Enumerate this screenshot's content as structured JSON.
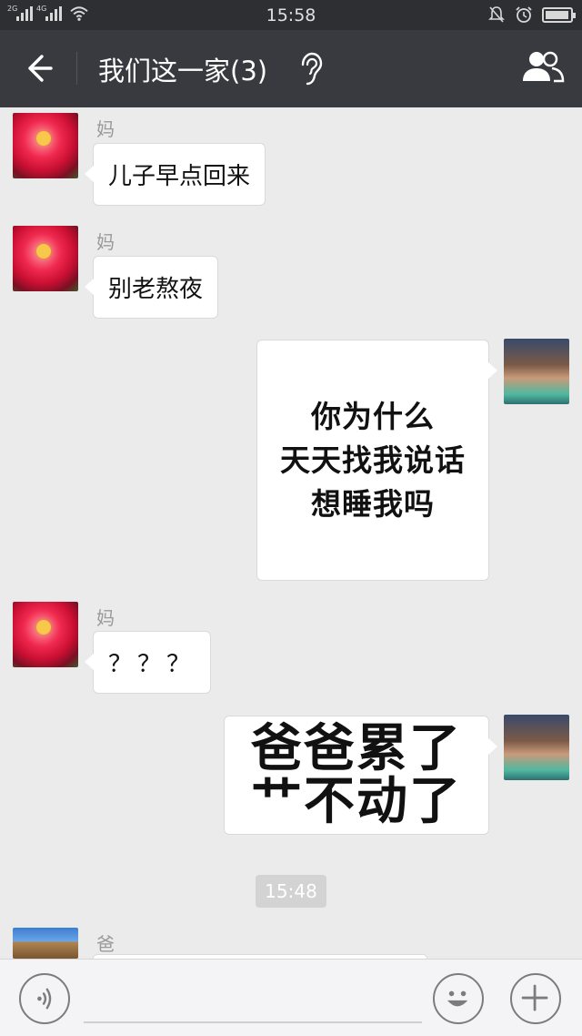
{
  "status_bar": {
    "network_1": "2G",
    "network_2": "4G",
    "time": "15:58",
    "battery_level": 0.95,
    "icons": [
      "signal-icon",
      "wifi-icon",
      "mute-bell-icon",
      "alarm-icon",
      "battery-icon"
    ]
  },
  "header": {
    "title": "我们这一家(3)",
    "back_icon": "arrow-left-icon",
    "earpiece_icon": "ear-icon",
    "group_icon": "group-people-icon"
  },
  "messages": [
    {
      "sender": "妈",
      "text": "儿子早点回来",
      "side": "left",
      "avatar": "red-flower"
    },
    {
      "sender": "妈",
      "text": "别老熬夜",
      "side": "left",
      "avatar": "red-flower"
    },
    {
      "side": "right",
      "type": "image",
      "image_text": [
        "你为什么",
        "天天找我说话",
        "想睡我吗"
      ],
      "avatar": "self-photo"
    },
    {
      "sender": "妈",
      "text": "？？？",
      "side": "left",
      "avatar": "red-flower"
    },
    {
      "side": "right",
      "type": "image",
      "image_text": [
        "爸爸累了",
        "艹不动了"
      ],
      "avatar": "self-photo"
    },
    {
      "sender": "爸",
      "side": "left",
      "avatar": "great-wall"
    }
  ],
  "timestamp": "15:48",
  "input_bar": {
    "voice_icon": "voice-icon",
    "emoji_icon": "emoji-icon",
    "plus_icon": "plus-icon",
    "input_value": ""
  },
  "colors": {
    "header_bg": "#393a3f",
    "chat_bg": "#ebebeb",
    "bubble_bg": "#ffffff"
  }
}
